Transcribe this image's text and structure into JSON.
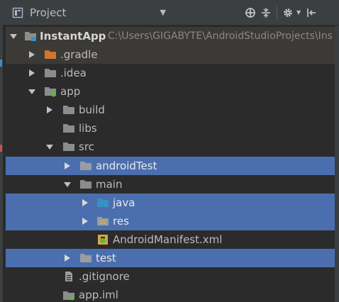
{
  "toolbar": {
    "panel_title": "Project",
    "icons": [
      "project-view-icon",
      "caret-down-icon",
      "locate-icon",
      "collapse-all-icon",
      "gear-icon",
      "hide-panel-icon"
    ]
  },
  "colors": {
    "background": "#2b2b2b",
    "toolbar": "#3c3f41",
    "selection": "#4b6eaf",
    "folder": "#8a8d8f",
    "folder_excluded": "#d0752e",
    "folder_source": "#3592c4",
    "text": "#bbbbbb"
  },
  "tree": {
    "root": {
      "label": "InstantApp",
      "path": "C:\\Users\\GIGABYTE\\AndroidStudioProjects\\Ins"
    },
    "items": [
      {
        "label": ".gradle",
        "icon": "folder-excluded-icon",
        "toggle": "collapsed"
      },
      {
        "label": ".idea",
        "icon": "folder-icon",
        "toggle": "collapsed"
      },
      {
        "label": "app",
        "icon": "module-folder-icon",
        "toggle": "expanded"
      },
      {
        "label": "build",
        "icon": "folder-icon",
        "toggle": "collapsed"
      },
      {
        "label": "libs",
        "icon": "folder-icon",
        "toggle": "none"
      },
      {
        "label": "src",
        "icon": "folder-icon",
        "toggle": "expanded"
      },
      {
        "label": "androidTest",
        "icon": "folder-icon",
        "toggle": "collapsed",
        "selected": true
      },
      {
        "label": "main",
        "icon": "folder-icon",
        "toggle": "expanded"
      },
      {
        "label": "java",
        "icon": "source-folder-icon",
        "toggle": "collapsed",
        "selected": true
      },
      {
        "label": "res",
        "icon": "resources-folder-icon",
        "toggle": "collapsed",
        "selected": true
      },
      {
        "label": "AndroidManifest.xml",
        "icon": "android-manifest-icon",
        "toggle": "none"
      },
      {
        "label": "test",
        "icon": "folder-icon",
        "toggle": "collapsed",
        "selected": true
      },
      {
        "label": ".gitignore",
        "icon": "text-file-icon",
        "toggle": "none"
      },
      {
        "label": "app.iml",
        "icon": "iml-file-icon",
        "toggle": "none"
      }
    ]
  }
}
